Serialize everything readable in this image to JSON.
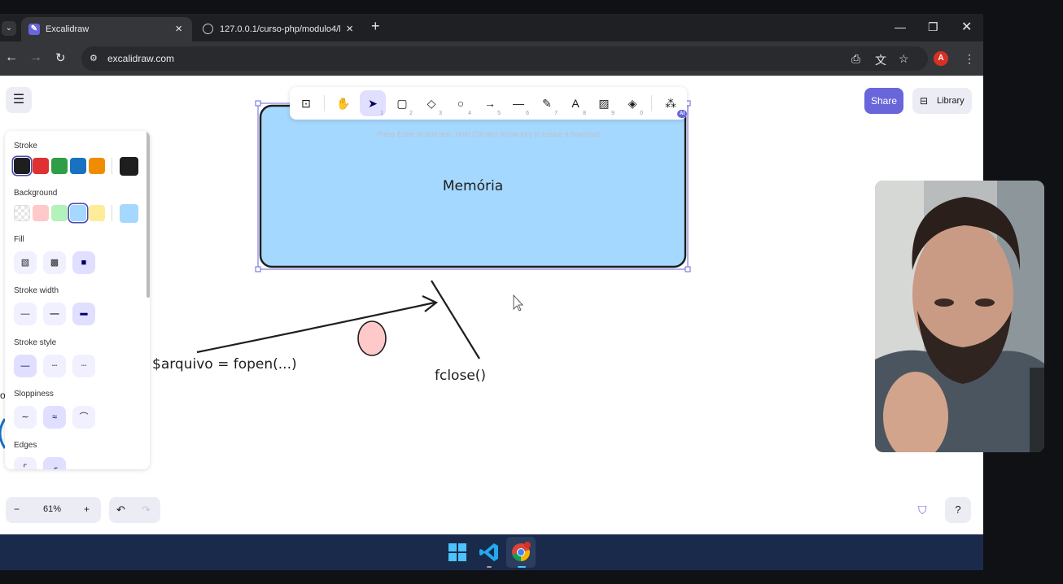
{
  "browser": {
    "tabs": [
      {
        "title": "Excalidraw",
        "active": true
      },
      {
        "title": "127.0.0.1/curso-php/modulo4/l",
        "active": false
      }
    ],
    "url": "excalidraw.com",
    "profile_initial": "A"
  },
  "toolbar": {
    "tools": [
      {
        "icon": "lock-icon",
        "key": ""
      },
      {
        "icon": "hand-icon",
        "key": ""
      },
      {
        "icon": "select-icon",
        "key": "1",
        "active": true
      },
      {
        "icon": "rectangle-icon",
        "key": "2"
      },
      {
        "icon": "diamond-icon",
        "key": "3"
      },
      {
        "icon": "ellipse-icon",
        "key": "4"
      },
      {
        "icon": "arrow-icon",
        "key": "5"
      },
      {
        "icon": "line-icon",
        "key": "6"
      },
      {
        "icon": "draw-icon",
        "key": "7"
      },
      {
        "icon": "text-icon",
        "key": "8"
      },
      {
        "icon": "image-icon",
        "key": "9"
      },
      {
        "icon": "eraser-icon",
        "key": "0"
      },
      {
        "icon": "extra-tools-icon",
        "key": ""
      }
    ],
    "ai_badge": "AI",
    "hint": "Press Enter to add text. Hold Ctrl and Arrow key to create a flowchart"
  },
  "header": {
    "share_label": "Share",
    "library_label": "Library"
  },
  "properties": {
    "stroke_label": "Stroke",
    "stroke_colors": [
      "#1e1e1e",
      "#e03131",
      "#2f9e44",
      "#1971c2",
      "#f08c00"
    ],
    "stroke_current": "#1e1e1e",
    "background_label": "Background",
    "background_colors": [
      "transparent",
      "#ffc9c9",
      "#b2f2bb",
      "#a5d8ff",
      "#ffec99"
    ],
    "background_current": "#a5d8ff",
    "fill_label": "Fill",
    "stroke_width_label": "Stroke width",
    "stroke_style_label": "Stroke style",
    "sloppiness_label": "Sloppiness",
    "edges_label": "Edges"
  },
  "canvas": {
    "rect_label": "Memória",
    "fopen_text": "$arquivo = fopen(...)",
    "fclose_text": "fclose()",
    "rect_fill": "#a5d8ff",
    "circle_fill": "#ffc9c9"
  },
  "bottom": {
    "zoom_level": "61%"
  },
  "accent_color": "#6965db"
}
